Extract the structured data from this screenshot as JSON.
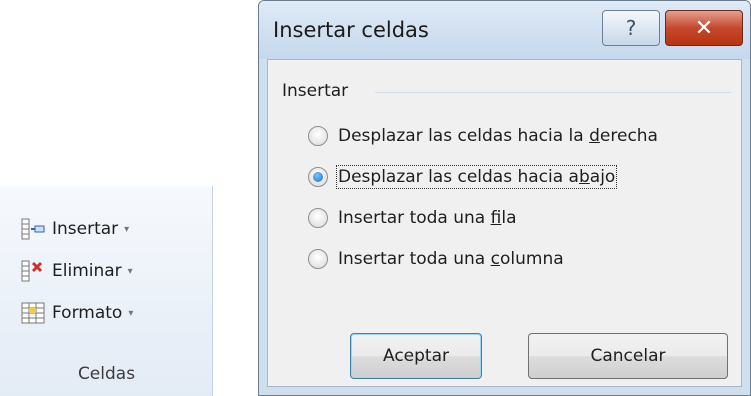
{
  "ribbon": {
    "insert_label": "Insertar",
    "delete_label": "Eliminar",
    "format_label": "Formato",
    "dropdown_arrow": "▾",
    "group_label": "Celdas"
  },
  "dialog": {
    "title": "Insertar celdas",
    "help_glyph": "?",
    "close_glyph": "✕",
    "group_title": "Insertar",
    "options": [
      {
        "before": "Desplazar las celdas hacia la ",
        "key": "d",
        "after": "erecha",
        "checked": false
      },
      {
        "before": "Desplazar las celdas hacia a",
        "key": "b",
        "after": "ajo",
        "checked": true
      },
      {
        "before": "Insertar toda una ",
        "key": "f",
        "after": "ila",
        "checked": false
      },
      {
        "before": "Insertar toda una ",
        "key": "c",
        "after": "olumna",
        "checked": false
      }
    ],
    "ok_label": "Aceptar",
    "cancel_label": "Cancelar"
  },
  "colors": {
    "close_button": "#c5482c",
    "selected_radio": "#1b6fc1",
    "ribbon_background": "#e3ebf5"
  }
}
